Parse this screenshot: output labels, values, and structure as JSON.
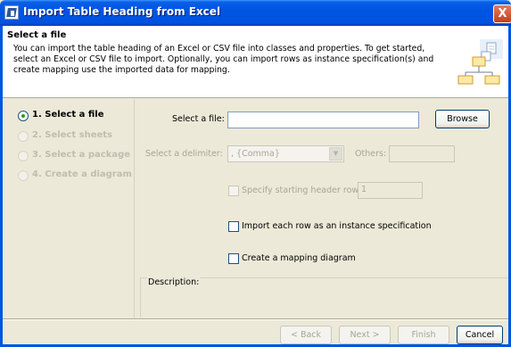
{
  "window": {
    "title": "Import Table Heading from Excel",
    "close_glyph": "X"
  },
  "header": {
    "title": "Select a file",
    "description": "You can import the table heading of an Excel or CSV file into classes and properties. To get started, select an Excel or CSV file to import. Optionally, you can import rows as instance specification(s) and create mapping use the imported data for mapping."
  },
  "steps": [
    {
      "label": "1. Select a file",
      "active": true
    },
    {
      "label": "2. Select sheets",
      "active": false
    },
    {
      "label": "3. Select a package",
      "active": false
    },
    {
      "label": "4. Create a diagram",
      "active": false
    }
  ],
  "form": {
    "file_label": "Select a file:",
    "file_value": "",
    "browse_label": "Browse",
    "delimiter_label": "Select a delimiter:",
    "delimiter_value": ", {Comma}",
    "others_label": "Others:",
    "others_value": "",
    "header_row_label": "Specify starting header row",
    "header_row_value": "1",
    "header_row_checked": false,
    "import_rows_label": "Import each row as an instance specification",
    "import_rows_checked": false,
    "mapping_label": "Create a mapping diagram",
    "mapping_checked": false,
    "description_label": "Description:"
  },
  "footer": {
    "back_label": "< Back",
    "next_label": "Next >",
    "finish_label": "Finish",
    "cancel_label": "Cancel"
  },
  "icons": {
    "app": "window-app-icon",
    "close": "close-icon",
    "wizard": "wizard-diagram-icon",
    "dropdown": "chevron-down-icon"
  },
  "colors": {
    "titlebar": "#0054e3",
    "dialog_bg": "#ece9d8",
    "active_radio": "#21a121",
    "disabled_text": "#a8a597"
  }
}
